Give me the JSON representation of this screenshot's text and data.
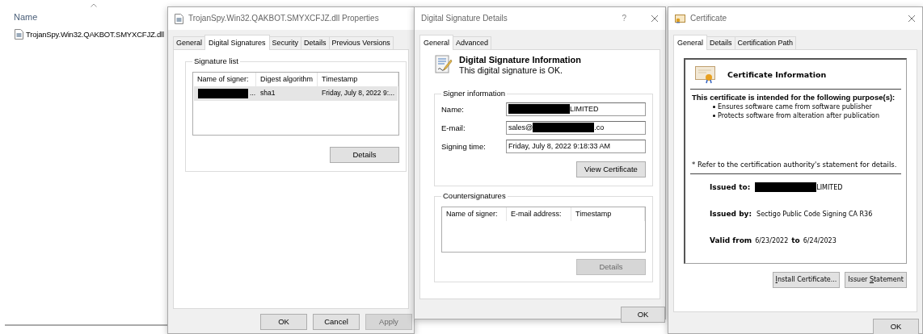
{
  "explorer": {
    "column_header": "Name",
    "files": [
      {
        "name": "TrojanSpy.Win32.QAKBOT.SMYXCFJZ.dll",
        "selected": false
      }
    ]
  },
  "properties_window": {
    "title": "TrojanSpy.Win32.QAKBOT.SMYXCFJZ.dll Properties",
    "tabs": [
      {
        "label": "General",
        "selected": false
      },
      {
        "label": "Digital Signatures",
        "selected": true
      },
      {
        "label": "Security",
        "selected": false
      },
      {
        "label": "Details",
        "selected": false
      },
      {
        "label": "Previous Versions",
        "selected": false
      }
    ],
    "group_title": "Signature list",
    "table": {
      "columns": [
        "Name of signer:",
        "Digest algorithm",
        "Timestamp"
      ],
      "rows": [
        {
          "selected": true,
          "cells": [
            {
              "redacted": true,
              "text": "..."
            },
            {
              "text": "sha1"
            },
            {
              "text": "Friday, July 8, 2022 9:..."
            }
          ]
        }
      ]
    },
    "details_button": {
      "label": "Details",
      "disabled": false
    },
    "buttons": [
      {
        "label": "OK",
        "disabled": false
      },
      {
        "label": "Cancel",
        "disabled": false
      },
      {
        "label": "Apply",
        "disabled": true
      }
    ]
  },
  "details_window": {
    "title": "Digital Signature Details",
    "help": "?",
    "tabs": [
      {
        "label": "General",
        "selected": true
      },
      {
        "label": "Advanced",
        "selected": false
      }
    ],
    "heading": "Digital Signature Information",
    "status": "This digital signature is OK.",
    "signer_group": "Signer information",
    "fields": [
      {
        "label": "Name:",
        "redacted": true,
        "suffix": "LIMITED"
      },
      {
        "label": "E-mail:",
        "prefix": "sales@",
        "redacted": true,
        "suffix": ".co"
      },
      {
        "label": "Signing time:",
        "suffix": "Friday, July 8, 2022 9:18:33 AM"
      }
    ],
    "view_button": {
      "label": "View Certificate",
      "disabled": false
    },
    "counter_group": "Countersignatures",
    "counter_columns": [
      "Name of signer:",
      "E-mail address:",
      "Timestamp"
    ],
    "counter_details_button": {
      "label": "Details",
      "disabled": true
    },
    "ok_button": {
      "label": "OK",
      "disabled": false
    }
  },
  "certificate_window": {
    "title": "Certificate",
    "tabs": [
      {
        "label": "General",
        "selected": true
      },
      {
        "label": "Details",
        "selected": false
      },
      {
        "label": "Certification Path",
        "selected": false
      }
    ],
    "heading": "Certificate Information",
    "purpose_title": "This certificate is intended for the following purpose(s):",
    "purposes": [
      "Ensures software came from software publisher",
      "Protects software from alteration after publication"
    ],
    "note": "* Refer to the certification authority's statement for details.",
    "issued_to": {
      "label": "Issued to:",
      "redacted": true,
      "suffix": "LIMITED"
    },
    "issued_by": {
      "label": "Issued by:",
      "value": "Sectigo Public Code Signing CA R36"
    },
    "valid": {
      "label": "Valid from",
      "from": "6/23/2022",
      "to_label": "to",
      "to": "6/24/2023"
    },
    "buttons": [
      {
        "key": "I",
        "after": "nstall Certificate...",
        "disabled": false
      },
      {
        "before": "Issuer ",
        "key": "S",
        "after": "tatement",
        "disabled": false
      }
    ],
    "ok_button": {
      "label": "OK",
      "disabled": false
    }
  }
}
